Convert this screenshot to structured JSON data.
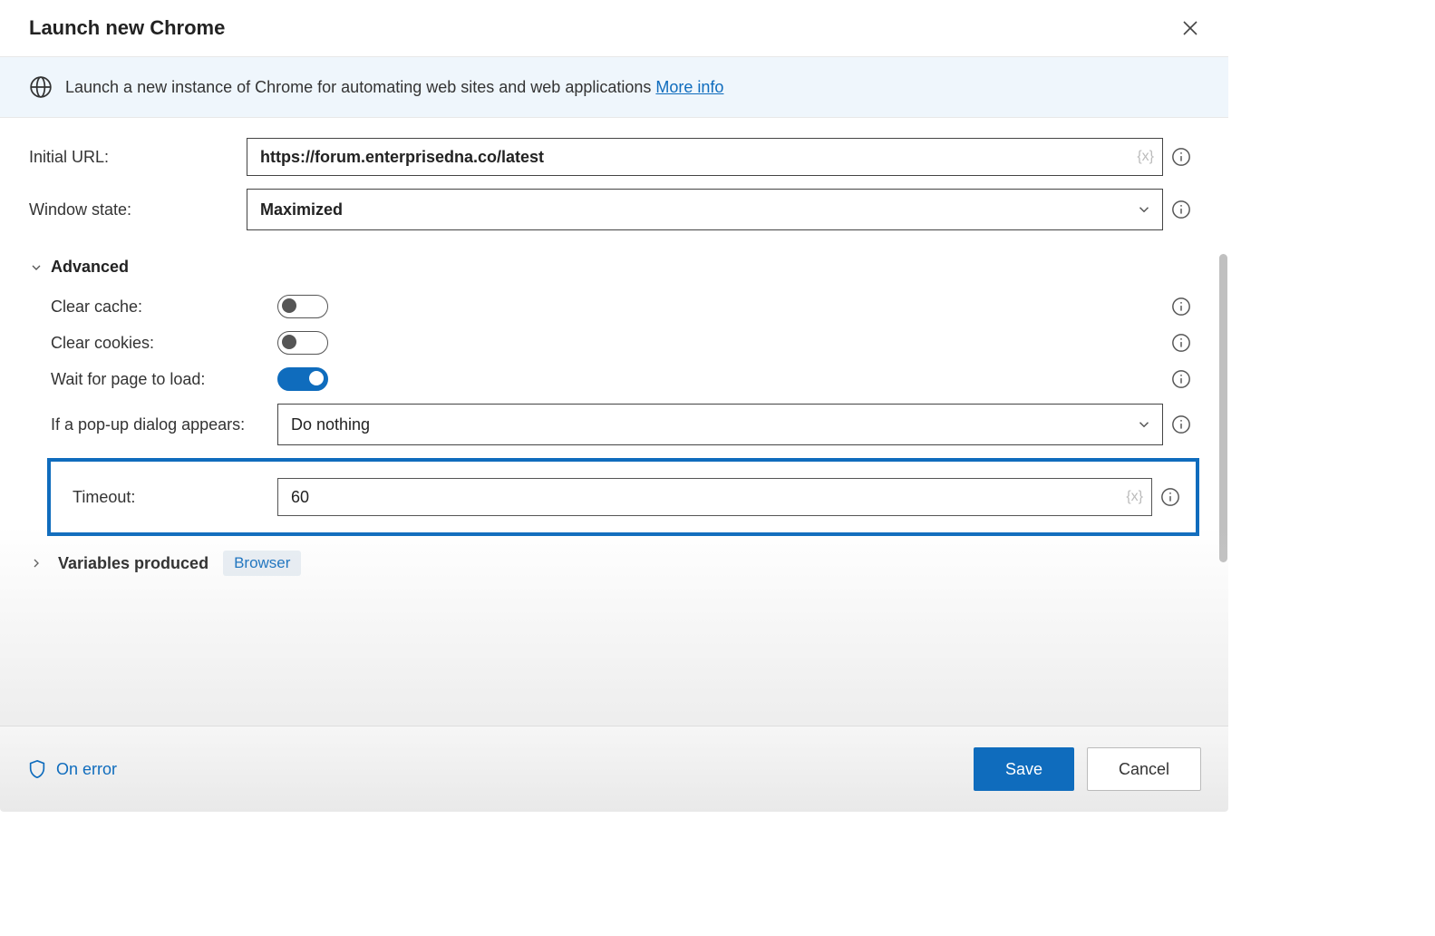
{
  "dialog": {
    "title": "Launch new Chrome",
    "banner_text": "Launch a new instance of Chrome for automating web sites and web applications ",
    "more_info": "More info"
  },
  "fields": {
    "initial_url": {
      "label": "Initial URL:",
      "value": "https://forum.enterprisedna.co/latest"
    },
    "window_state": {
      "label": "Window state:",
      "value": "Maximized"
    },
    "advanced_label": "Advanced",
    "clear_cache": {
      "label": "Clear cache:",
      "on": false
    },
    "clear_cookies": {
      "label": "Clear cookies:",
      "on": false
    },
    "wait_for_page": {
      "label": "Wait for page to load:",
      "on": true
    },
    "popup": {
      "label": "If a pop-up dialog appears:",
      "value": "Do nothing"
    },
    "timeout": {
      "label": "Timeout:",
      "value": "60"
    }
  },
  "variables": {
    "label": "Variables produced",
    "chip": "Browser"
  },
  "footer": {
    "on_error": "On error",
    "save": "Save",
    "cancel": "Cancel"
  },
  "glyphs": {
    "var_badge": "{x}"
  }
}
